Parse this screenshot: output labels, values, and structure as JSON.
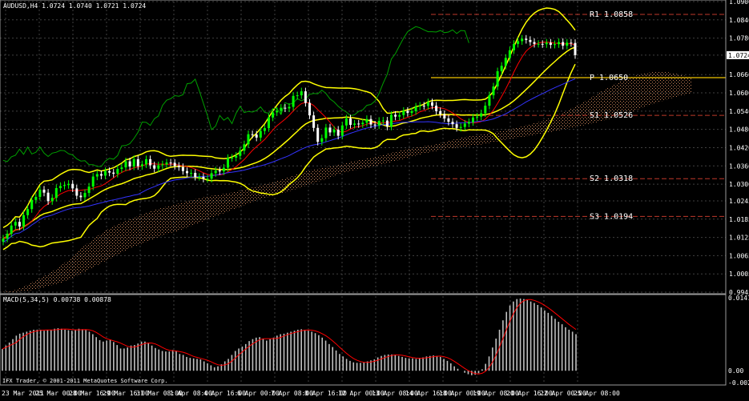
{
  "chart_data": {
    "type": "candlestick",
    "symbol_header": "AUDUSD,H4  1.0724 1.0740 1.0721 1.0724",
    "y_axis": {
      "ticks": [
        "1.0900",
        "1.0840",
        "1.0780",
        "1.0724",
        "1.0660",
        "1.0600",
        "1.0540",
        "1.0480",
        "1.0420",
        "1.0360",
        "1.0300",
        "1.0245",
        "1.0185",
        "1.0125",
        "1.0065",
        "1.0005",
        "0.9945"
      ],
      "ylim": [
        0.9945,
        1.09
      ],
      "current_price": "1.0724"
    },
    "x_axis": {
      "ticks": [
        "23 Mar 2011",
        "25 Mar 00:00",
        "28 Mar 16:00",
        "29 Mar 16:00",
        "31 Mar 08:00",
        "1 Apr 08:00",
        "4 Apr 16:00",
        "6 Apr 00:00",
        "7 Apr 08:00",
        "8 Apr 16:00",
        "12 Apr 00:00",
        "13 Apr 08:00",
        "14 Apr 16:00",
        "18 Apr 00:00",
        "19 Apr 08:00",
        "20 Apr 16:00",
        "22 Apr 00:00",
        "25 Apr 08:00"
      ]
    },
    "pivot_levels": [
      {
        "label": "R1",
        "value": "1.0858",
        "color": "#c0392b"
      },
      {
        "label": "P",
        "value": "1.0650",
        "color": "#c8a400"
      },
      {
        "label": "S1",
        "value": "1.0526",
        "color": "#c0392b"
      },
      {
        "label": "S2",
        "value": "1.0318",
        "color": "#c0392b"
      },
      {
        "label": "S3",
        "value": "1.0194",
        "color": "#c0392b"
      }
    ],
    "close": [
      1.0121,
      1.0137,
      1.0164,
      1.0176,
      1.0161,
      1.0198,
      1.0218,
      1.0248,
      1.0258,
      1.0282,
      1.0272,
      1.0244,
      1.0255,
      1.0287,
      1.0294,
      1.0297,
      1.0301,
      1.0286,
      1.0262,
      1.0257,
      1.0271,
      1.0292,
      1.0325,
      1.0333,
      1.0328,
      1.0343,
      1.0338,
      1.0334,
      1.035,
      1.0355,
      1.0375,
      1.0358,
      1.0382,
      1.0359,
      1.0365,
      1.0382,
      1.0362,
      1.0351,
      1.0362,
      1.0365,
      1.0371,
      1.037,
      1.036,
      1.0356,
      1.0343,
      1.0336,
      1.0337,
      1.0324,
      1.0324,
      1.0318,
      1.0318,
      1.0336,
      1.0345,
      1.0342,
      1.0354,
      1.0386,
      1.0387,
      1.0393,
      1.041,
      1.0431,
      1.0464,
      1.0463,
      1.0453,
      1.0475,
      1.0484,
      1.0519,
      1.0536,
      1.0541,
      1.0551,
      1.0549,
      1.0554,
      1.059,
      1.0592,
      1.0605,
      1.0567,
      1.0526,
      1.0485,
      1.0439,
      1.0451,
      1.0486,
      1.047,
      1.0479,
      1.0459,
      1.0493,
      1.0516,
      1.0495,
      1.0499,
      1.0497,
      1.0502,
      1.0514,
      1.0496,
      1.0493,
      1.0508,
      1.0509,
      1.0489,
      1.0528,
      1.0522,
      1.0527,
      1.0541,
      1.0534,
      1.054,
      1.0555,
      1.0558,
      1.0557,
      1.0569,
      1.0558,
      1.054,
      1.053,
      1.0516,
      1.0505,
      1.0497,
      1.0485,
      1.0488,
      1.0499,
      1.0504,
      1.0519,
      1.0522,
      1.0533,
      1.0558,
      1.0592,
      1.0621,
      1.0671,
      1.0689,
      1.0715,
      1.074,
      1.0761,
      1.077,
      1.0778,
      1.0774,
      1.0767,
      1.0761,
      1.0761,
      1.076,
      1.0765,
      1.0758,
      1.076,
      1.0767,
      1.0755,
      1.0765,
      1.0764,
      1.0724
    ],
    "ichimoku_cloud": {
      "upper": [
        0.9945,
        0.995,
        0.9965,
        0.9985,
        1.0005,
        1.003,
        1.006,
        1.0095,
        1.0125,
        1.015,
        1.017,
        1.0185,
        1.02,
        1.0215,
        1.0225,
        1.0235,
        1.0245,
        1.0255,
        1.0262,
        1.0268,
        1.0275,
        1.0285,
        1.0295,
        1.0305,
        1.0316,
        1.033,
        1.0342,
        1.035,
        1.0358,
        1.0365,
        1.0375,
        1.0382,
        1.039,
        1.04,
        1.041,
        1.0418,
        1.0424,
        1.043,
        1.044,
        1.045,
        1.0458,
        1.0463,
        1.047,
        1.0477,
        1.0485,
        1.0495,
        1.0505,
        1.052,
        1.0535,
        1.0555,
        1.0575,
        1.06,
        1.062,
        1.064,
        1.0655,
        1.0665,
        1.067,
        1.0668,
        1.066,
        1.065
      ],
      "lower": [
        0.9945,
        0.9945,
        0.9948,
        0.9955,
        0.9965,
        0.9975,
        0.999,
        1.001,
        1.003,
        1.005,
        1.007,
        1.009,
        1.0105,
        1.012,
        1.0135,
        1.0145,
        1.016,
        1.0175,
        1.019,
        1.0205,
        1.022,
        1.0235,
        1.0248,
        1.026,
        1.027,
        1.0282,
        1.0295,
        1.0308,
        1.032,
        1.0335,
        1.0345,
        1.0352,
        1.036,
        1.037,
        1.038,
        1.039,
        1.04,
        1.0408,
        1.0415,
        1.042,
        1.0425,
        1.043,
        1.0438,
        1.0445,
        1.0452,
        1.0458,
        1.0465,
        1.0472,
        1.048,
        1.0488,
        1.0495,
        1.0505,
        1.0515,
        1.0528,
        1.054,
        1.0555,
        1.0568,
        1.058,
        1.059,
        1.06
      ]
    },
    "macd": {
      "header": "MACD(5,34,5) 0.00738 0.00878",
      "y_ticks": [
        "0.01476",
        "0.00",
        "-0.00239"
      ],
      "ylim": [
        -0.00239,
        0.01476
      ],
      "histogram": [
        0.0044,
        0.0051,
        0.0057,
        0.0064,
        0.0071,
        0.0075,
        0.0077,
        0.0079,
        0.0081,
        0.0083,
        0.0083,
        0.0083,
        0.0081,
        0.0082,
        0.0083,
        0.0085,
        0.0086,
        0.0085,
        0.0083,
        0.0082,
        0.0081,
        0.0083,
        0.0085,
        0.0084,
        0.0083,
        0.0079,
        0.0074,
        0.0068,
        0.0062,
        0.0059,
        0.0061,
        0.0063,
        0.0058,
        0.0052,
        0.0045,
        0.0045,
        0.0047,
        0.0051,
        0.0052,
        0.0055,
        0.0059,
        0.0059,
        0.0056,
        0.0051,
        0.0046,
        0.0043,
        0.004,
        0.0039,
        0.0039,
        0.0042,
        0.004,
        0.0034,
        0.0032,
        0.0028,
        0.0026,
        0.0025,
        0.0024,
        0.0023,
        0.0019,
        0.0015,
        0.0011,
        0.0007,
        0.0009,
        0.0013,
        0.0019,
        0.0024,
        0.0032,
        0.004,
        0.0045,
        0.0049,
        0.0054,
        0.006,
        0.0064,
        0.0067,
        0.0068,
        0.0065,
        0.0061,
        0.0064,
        0.0067,
        0.0071,
        0.0074,
        0.0075,
        0.0077,
        0.0079,
        0.0081,
        0.0083,
        0.0084,
        0.0083,
        0.0081,
        0.0079,
        0.0076,
        0.0072,
        0.0067,
        0.0061,
        0.0054,
        0.0048,
        0.0041,
        0.0034,
        0.0029,
        0.0024,
        0.002,
        0.0017,
        0.0016,
        0.0016,
        0.0017,
        0.0019,
        0.0021,
        0.0023,
        0.0027,
        0.003,
        0.0032,
        0.0033,
        0.0033,
        0.0032,
        0.003,
        0.0028,
        0.0026,
        0.0025,
        0.0025,
        0.0024,
        0.0026,
        0.0027,
        0.0029,
        0.003,
        0.0031,
        0.003,
        0.0028,
        0.0024,
        0.002,
        0.0015,
        0.0009,
        0.0004,
        0.0,
        -0.0004,
        -0.0007,
        -0.0009,
        -0.0008,
        -0.0005,
        0.0003,
        0.0014,
        0.0029,
        0.0047,
        0.0065,
        0.0083,
        0.0102,
        0.0119,
        0.0132,
        0.014,
        0.0145,
        0.0146,
        0.0145,
        0.0143,
        0.014,
        0.0137,
        0.0133,
        0.0128,
        0.0122,
        0.0117,
        0.0111,
        0.0105,
        0.0099,
        0.0094,
        0.0088,
        0.0083,
        0.0079,
        0.0074
      ]
    }
  },
  "colors": {
    "bollinger": "#ffff00",
    "ma_red": "#ff0000",
    "ma_blue": "#3333ff",
    "chikou_green": "#00a000",
    "cloud": "#c8845a",
    "candle_up": "#00ff00",
    "candle_down": "#ffffff",
    "grid": "#404040",
    "macd_signal": "#ff0000",
    "macd_hist": "#c0c0c0"
  },
  "footer": "IFX Trader, © 2001-2011 MetaQuotes Software Corp."
}
